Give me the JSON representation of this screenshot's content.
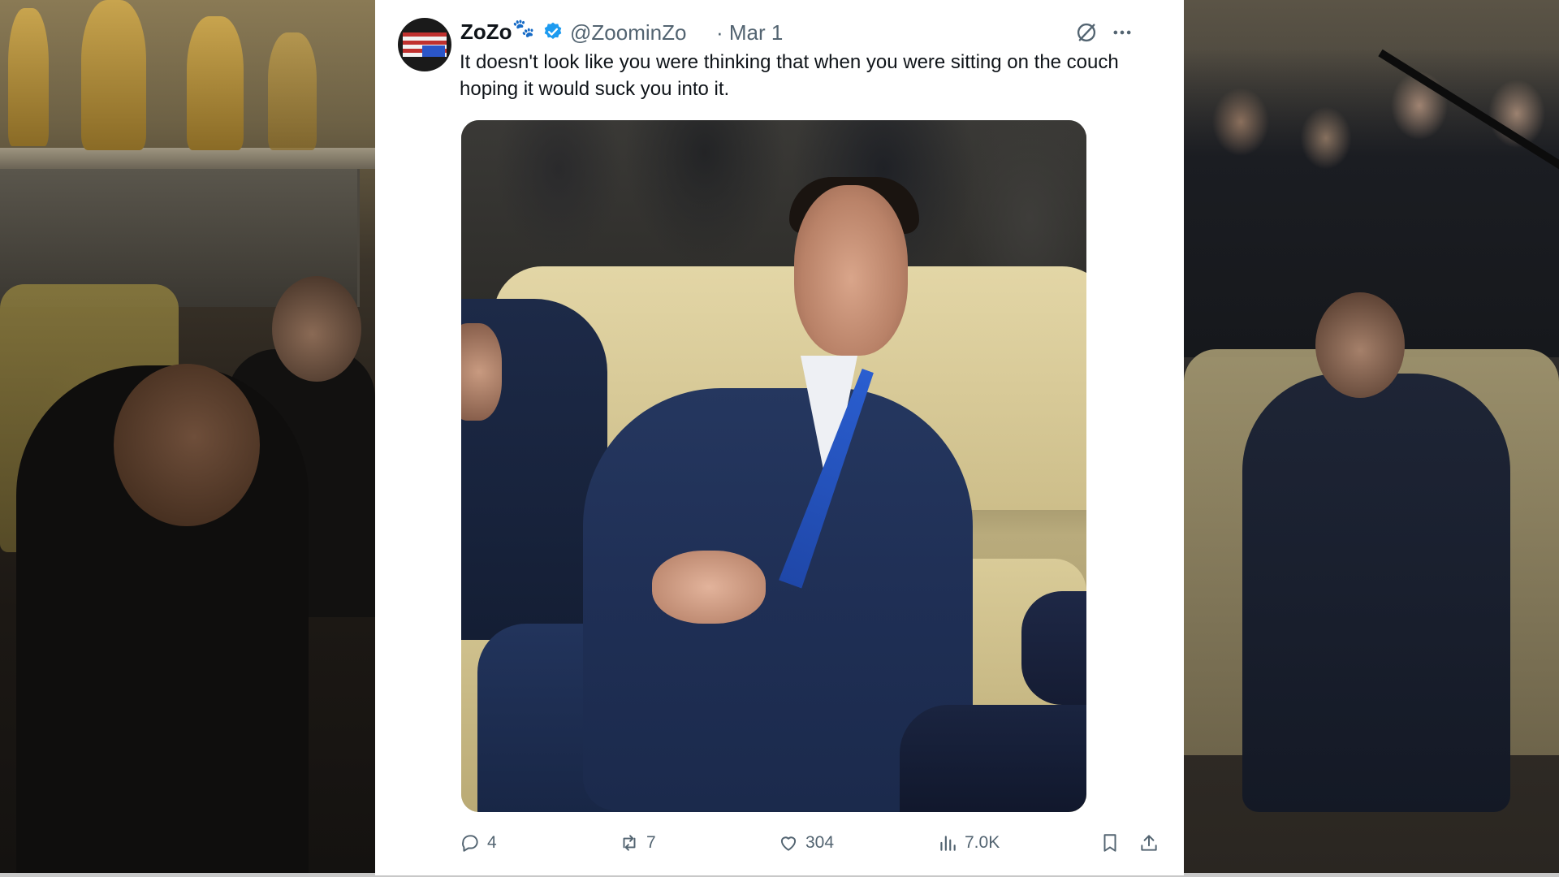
{
  "tweet": {
    "display_name": "ZoZo",
    "name_emoji": "🐾",
    "handle": "@ZoominZo",
    "date": "· Mar 1",
    "text": "It doesn't look like you were thinking that when you were sitting on the couch hoping it would suck you into it.",
    "verified_color": "#1d9bf0",
    "icons": {
      "grok": "grok-icon",
      "more": "more-icon"
    }
  },
  "actions": {
    "replies": "4",
    "reposts": "7",
    "likes": "304",
    "views": "7.0K",
    "icons": [
      "reply-icon",
      "repost-icon",
      "like-icon",
      "views-icon",
      "bookmark-icon",
      "share-icon"
    ]
  },
  "colors": {
    "text_primary": "#0f1419",
    "text_secondary": "#536471",
    "card_background": "#ffffff"
  }
}
